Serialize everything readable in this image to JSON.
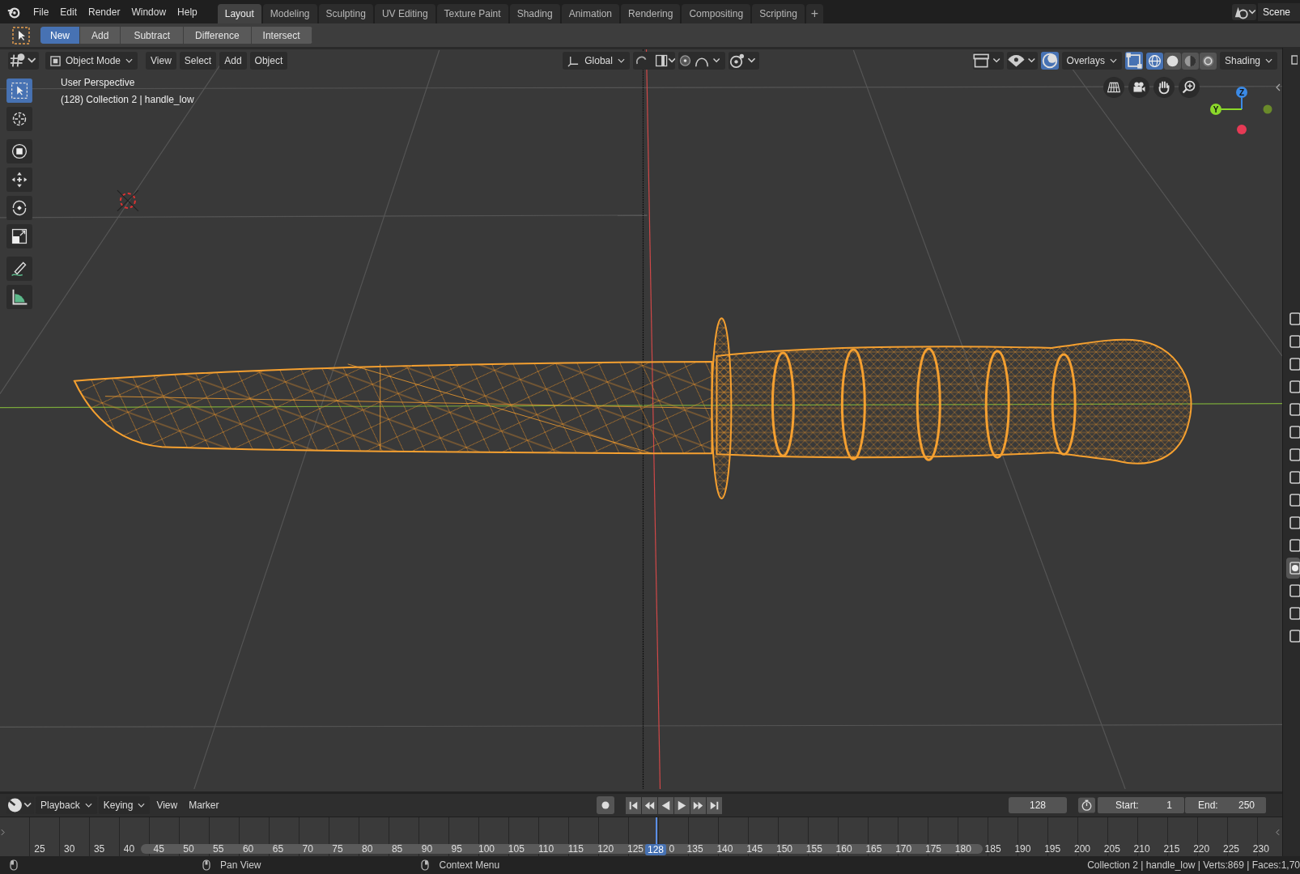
{
  "menu": [
    "File",
    "Edit",
    "Render",
    "Window",
    "Help"
  ],
  "workspaces": [
    {
      "label": "Layout",
      "selected": true
    },
    {
      "label": "Modeling",
      "selected": false
    },
    {
      "label": "Sculpting",
      "selected": false
    },
    {
      "label": "UV Editing",
      "selected": false
    },
    {
      "label": "Texture Paint",
      "selected": false
    },
    {
      "label": "Shading",
      "selected": false
    },
    {
      "label": "Animation",
      "selected": false
    },
    {
      "label": "Rendering",
      "selected": false
    },
    {
      "label": "Compositing",
      "selected": false
    },
    {
      "label": "Scripting",
      "selected": false
    }
  ],
  "add_workspace": "+",
  "scene": "Scene",
  "tool_header": {
    "modes": [
      {
        "label": "New",
        "selected": true
      },
      {
        "label": "Add",
        "selected": false
      },
      {
        "label": "Subtract",
        "selected": false
      },
      {
        "label": "Difference",
        "selected": false
      },
      {
        "label": "Intersect",
        "selected": false
      }
    ]
  },
  "viewport_header": {
    "mode": "Object Mode",
    "menus": [
      "View",
      "Select",
      "Add",
      "Object"
    ],
    "orientation": "Global",
    "overlays": "Overlays",
    "shading": "Shading",
    "shading_modes": [
      {
        "kind": "wireframe",
        "selected": true
      },
      {
        "kind": "solid",
        "selected": false
      },
      {
        "kind": "material",
        "selected": false
      },
      {
        "kind": "rendered",
        "selected": false
      }
    ]
  },
  "viewport": {
    "info": [
      "User Perspective",
      "(128) Collection 2 | handle_low"
    ],
    "gizmo_labels": [
      "Z",
      "Y"
    ],
    "tools": [
      {
        "kind": "select_box",
        "selected": true
      },
      {
        "kind": "cursor",
        "selected": false
      },
      {
        "kind": "transform",
        "selected": false
      },
      {
        "kind": "move",
        "selected": false
      },
      {
        "kind": "rotate",
        "selected": false
      },
      {
        "kind": "scale",
        "selected": false
      },
      {
        "kind": "annotate",
        "selected": false
      },
      {
        "kind": "measure",
        "selected": false
      }
    ]
  },
  "properties_tabs": [
    {
      "selected": false
    },
    {
      "selected": false
    },
    {
      "selected": false
    },
    {
      "selected": false
    },
    {
      "selected": false
    },
    {
      "selected": false
    },
    {
      "selected": false
    },
    {
      "selected": false
    },
    {
      "selected": false
    },
    {
      "selected": false
    },
    {
      "selected": false
    },
    {
      "selected": true
    },
    {
      "selected": false
    },
    {
      "selected": false
    },
    {
      "selected": false
    }
  ],
  "timeline": {
    "menus": [
      "Playback",
      "Keying",
      "View",
      "Marker"
    ],
    "current_frame": "128",
    "start_label": "Start:",
    "start": "1",
    "end_label": "End:",
    "end": "250",
    "playhead_label": "128",
    "ticks": [
      "25",
      "30",
      "35",
      "40",
      "45",
      "50",
      "55",
      "60",
      "65",
      "70",
      "75",
      "80",
      "85",
      "90",
      "95",
      "100",
      "105",
      "110",
      "115",
      "120",
      "125",
      "0",
      "135",
      "140",
      "145",
      "150",
      "155",
      "160",
      "165",
      "170",
      "175",
      "180",
      "185",
      "190",
      "195",
      "200",
      "205",
      "210",
      "215",
      "220",
      "225",
      "230"
    ]
  },
  "status_bar": {
    "hints": [
      "Pan View",
      "Context Menu"
    ],
    "stats": "Collection 2 | handle_low | Verts:869 | Faces:1,70"
  }
}
